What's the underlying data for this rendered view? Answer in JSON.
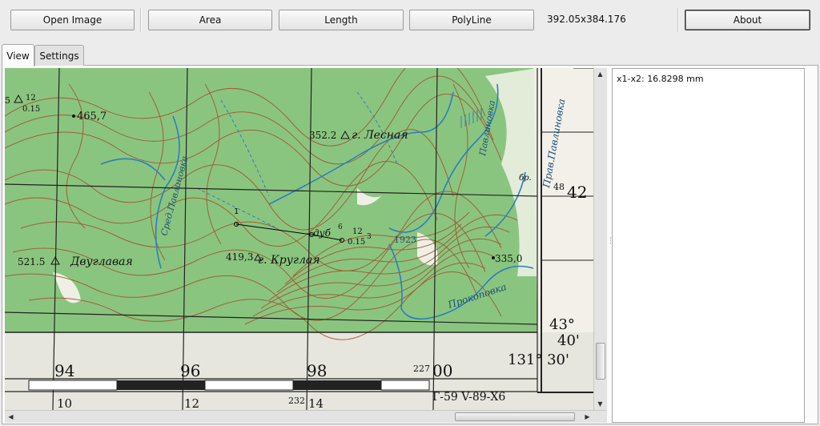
{
  "toolbar": {
    "open_image": "Open Image",
    "area": "Area",
    "length": "Length",
    "polyline": "PolyLine",
    "coords": "392.05x384.176",
    "about": "About"
  },
  "tabs": [
    {
      "label": "View",
      "active": true
    },
    {
      "label": "Settings",
      "active": false
    }
  ],
  "map": {
    "labels": {
      "l_465": "465,7",
      "l_512_top": "5",
      "l_12a": "12",
      "l_015a": "0.15",
      "l_352": "352.2",
      "l_lesnaya": "г. Лесная",
      "l_sredpavl": "Сред.Павлиновка",
      "l_pravpavl": "Прав.Павлиновка",
      "l_pavl2": "Павлиновка",
      "l_br": "бр.",
      "l_48": "48",
      "l_42": "42",
      "l_dub": "дуб",
      "l_6": "6",
      "l_12b": "12",
      "l_015b": "0.15",
      "l_3": "3",
      "l_1923": "1923",
      "l_521": "521.5",
      "l_dvuglav": "Двуглавая",
      "l_419": "419,3",
      "l_krugl": "г. Круглая",
      "l_335": "335,0",
      "l_prokop": "Прокоповка",
      "l_43": "43°",
      "l_40": "40'",
      "l_131": "131° 30'",
      "l_94": "94",
      "l_96": "96",
      "l_98": "98",
      "l_227": "227",
      "l_00": "00",
      "l_10": "10",
      "l_12c": "12",
      "l_232": "232",
      "l_14": "14",
      "l_sheet": "Г-59 V-89-Х6"
    },
    "measure": {
      "point_label": "1"
    }
  },
  "log": {
    "lines": [
      "x1-x2: 16.8298 mm"
    ]
  },
  "colors": {
    "forest": "#8ac57f",
    "contour": "#a0502a",
    "water": "#2a7fbf",
    "grid": "#222222",
    "paper": "#e6e6df"
  }
}
